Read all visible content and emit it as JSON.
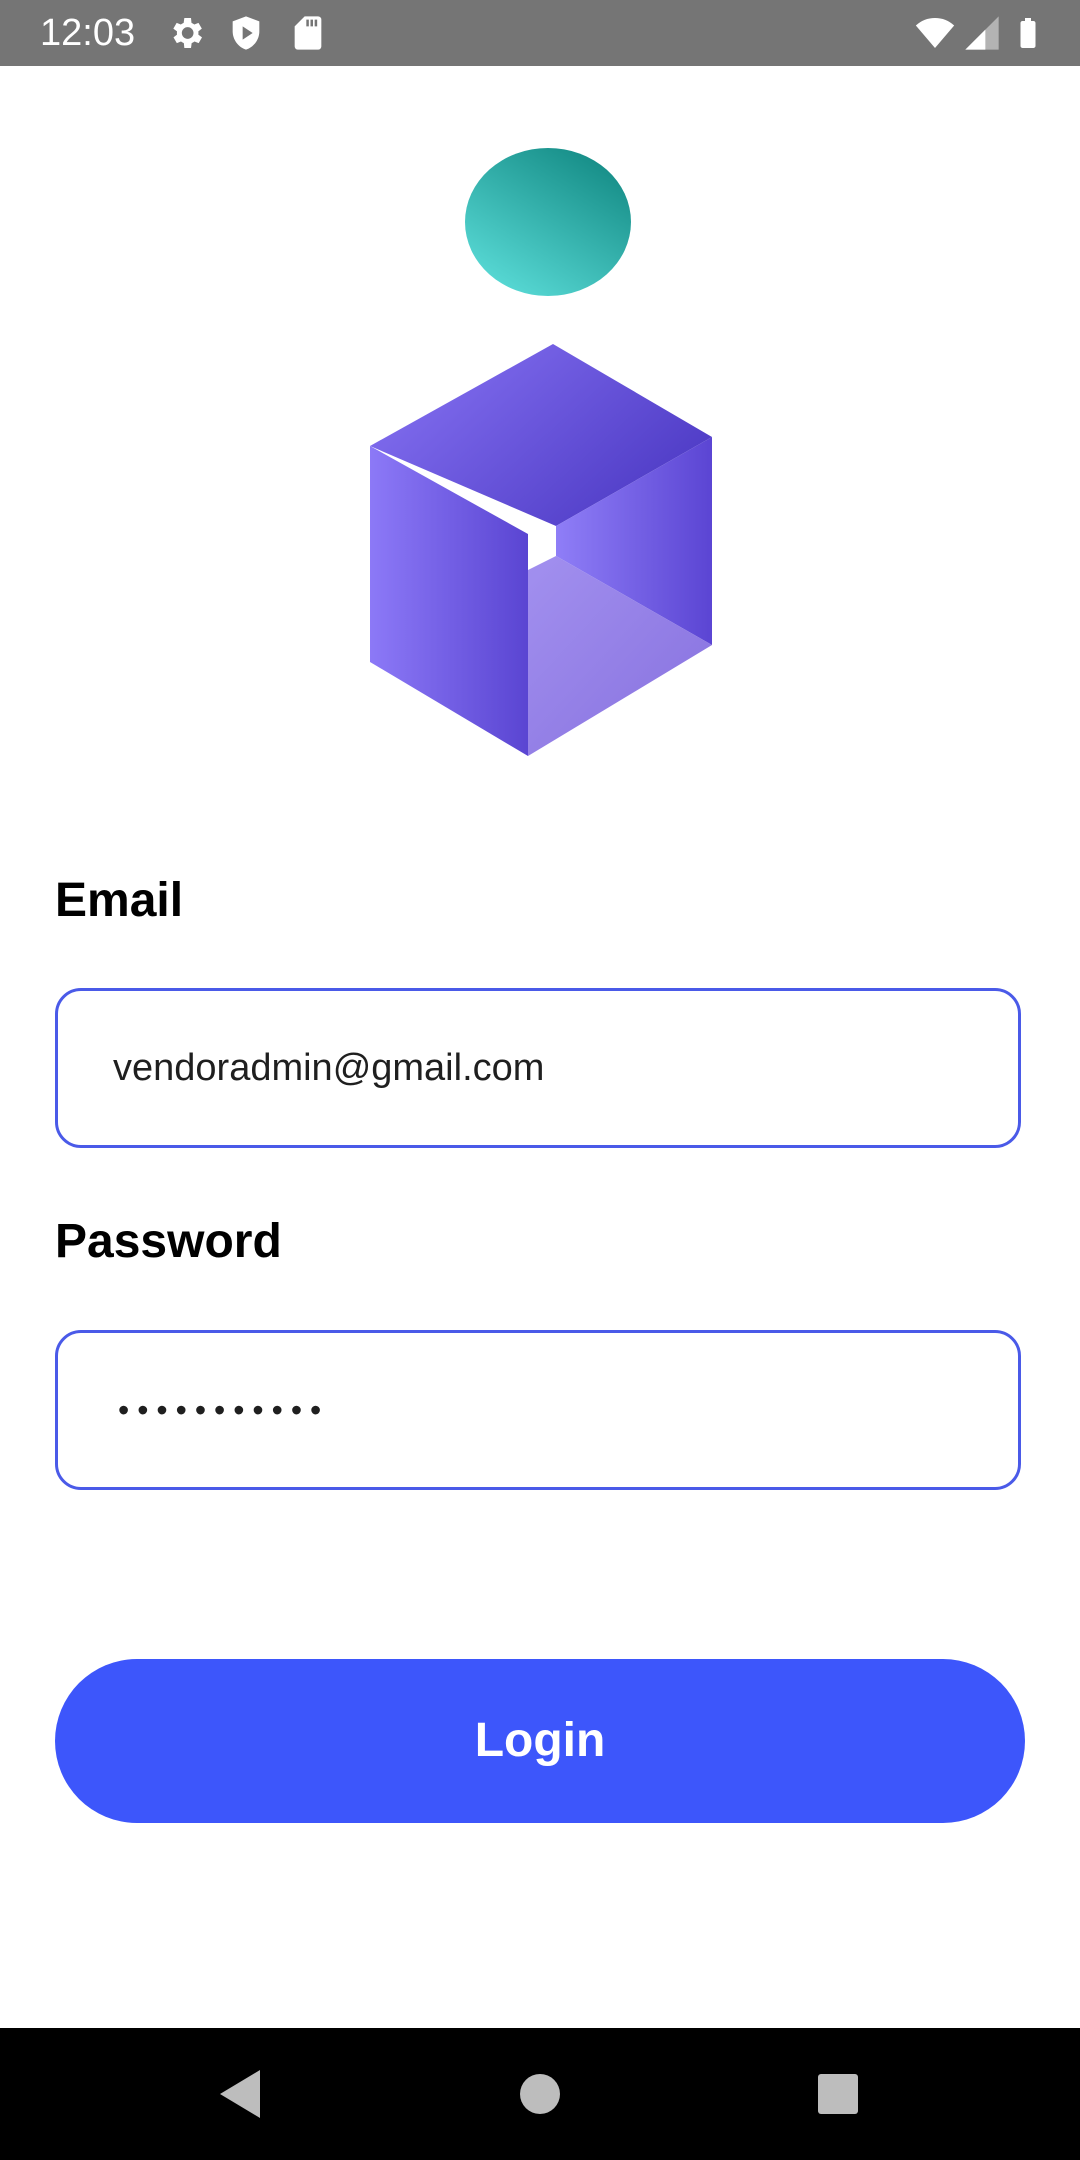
{
  "status_bar": {
    "time": "12:03",
    "left_icons": [
      "settings-icon",
      "shield-play-icon",
      "sd-card-icon"
    ],
    "right_icons": [
      "wifi-icon",
      "cellular-signal-icon",
      "battery-icon"
    ]
  },
  "logo": {
    "icon": "cube-logo-icon",
    "colors": {
      "orb_top": "#138a84",
      "orb_bottom": "#5ee0dc",
      "cube_light": "#8b77f5",
      "cube_dark": "#5a40cf"
    }
  },
  "form": {
    "email_label": "Email",
    "email_value": "vendoradmin@gmail.com",
    "password_label": "Password",
    "password_value": "•••••••••••",
    "login_label": "Login"
  },
  "colors": {
    "accent": "#3d56fb",
    "field_border": "#4a5ae8",
    "status_bar": "#757575",
    "nav_bar": "#000000"
  },
  "nav_bar": {
    "buttons": [
      "back-icon",
      "home-icon",
      "recents-icon"
    ]
  }
}
